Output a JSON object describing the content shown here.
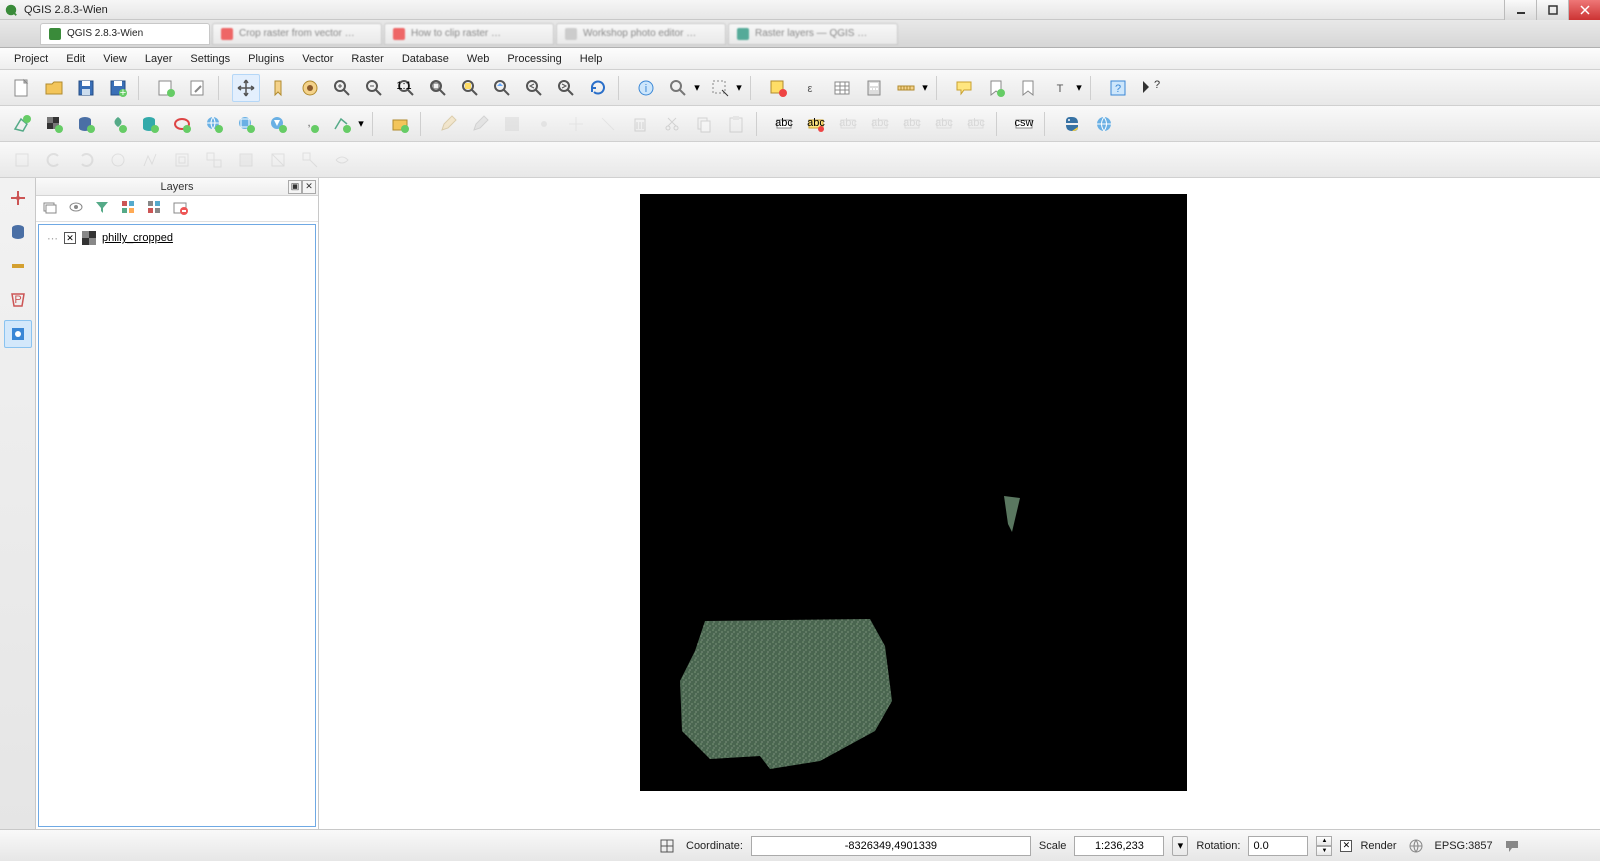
{
  "window": {
    "title": "QGIS 2.8.3-Wien"
  },
  "browser_tabs": [
    {
      "label": "QGIS 2.8.3-Wien",
      "active": true
    },
    {
      "label": "Crop raster from vector …",
      "active": false
    },
    {
      "label": "How to clip raster …",
      "active": false
    },
    {
      "label": "Workshop photo editor …",
      "active": false
    },
    {
      "label": "Raster layers — QGIS …",
      "active": false
    }
  ],
  "menu": [
    "Project",
    "Edit",
    "View",
    "Layer",
    "Settings",
    "Plugins",
    "Vector",
    "Raster",
    "Database",
    "Web",
    "Processing",
    "Help"
  ],
  "layers_panel": {
    "title": "Layers",
    "items": [
      {
        "name": "philly_cropped",
        "checked": true
      }
    ]
  },
  "status": {
    "coordinate_label": "Coordinate:",
    "coordinate_value": "-8326349,4901339",
    "scale_label": "Scale",
    "scale_value": "1:236,233",
    "rotation_label": "Rotation:",
    "rotation_value": "0.0",
    "render_label": "Render",
    "render_checked": true,
    "crs": "EPSG:3857"
  },
  "colors": {
    "accent": "#3a87d6",
    "panel_border": "#6fa9e4"
  }
}
